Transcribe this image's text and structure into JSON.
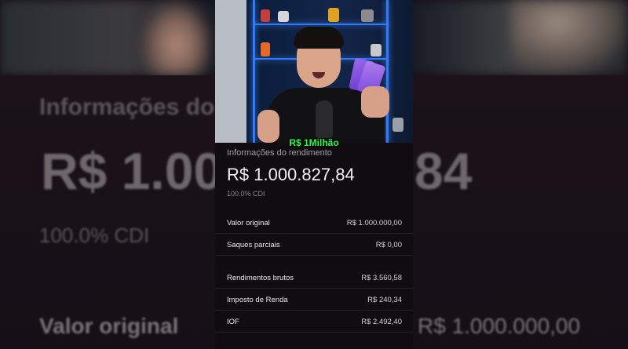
{
  "caption": "R$ 1Milhão",
  "info": {
    "title": "Informações do rendimento",
    "amount": "R$ 1.000.827,84",
    "cdi": "100.0% CDI",
    "rows": [
      {
        "label": "Valor original",
        "value": "R$ 1.000.000,00"
      },
      {
        "label": "Saques parciais",
        "value": "R$ 0,00"
      },
      {
        "label": "Rendimentos brutos",
        "value": "R$ 3.560,58"
      },
      {
        "label": "Imposto de Renda",
        "value": "R$ 240,34"
      },
      {
        "label": "IOF",
        "value": "R$ 2.492,40"
      }
    ]
  },
  "background": {
    "heading": "Informações do",
    "amount": "R$ 1.000",
    "amount_right": "84",
    "cdi": "100.0% CDI",
    "label": "Valor original",
    "value": "R$ 1.000.000,00"
  },
  "colors": {
    "caption": "#2aff42",
    "panel_bg": "#110c12"
  }
}
